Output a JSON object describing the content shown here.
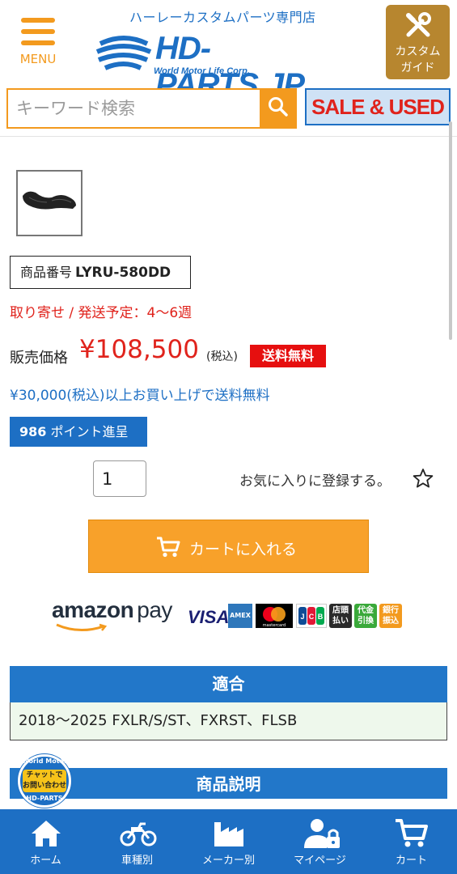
{
  "header": {
    "menu_label": "MENU",
    "tagline": "ハーレーカスタムパーツ専門店",
    "logo_text": "HD-PARTS.JP",
    "logo_sub": "World Motor Life Corp.",
    "guide_label_1": "カスタム",
    "guide_label_2": "ガイド"
  },
  "search": {
    "placeholder": "キーワード検索",
    "value": ""
  },
  "sale_banner": "SALE & USED",
  "product": {
    "sku_label": "商品番号",
    "sku": "LYRU-580DD",
    "ship_schedule": "取り寄せ / 発送予定：4〜6週",
    "price_label": "販売価格",
    "price": "¥108,500",
    "price_tax": "(税込)",
    "free_shipping_badge": "送料無料",
    "free_shipping_note": "¥30,000(税込)以上お買い上げで送料無料",
    "points": "986",
    "points_suffix": " ポイント進呈",
    "quantity": "1",
    "favorite_label": "お気に入りに登録する。",
    "cart_button": "カートに入れる"
  },
  "payments": {
    "amazon": "amazon",
    "pay": "pay",
    "visa": "VISA",
    "amex": "AMERICAN EXPRESS",
    "mastercard": "mastercard",
    "jcb": "JCB",
    "store_pay": [
      "店頭",
      "払い"
    ],
    "cod": [
      "代金",
      "引換"
    ],
    "bank": [
      "銀行",
      "振込"
    ]
  },
  "compat": {
    "heading": "適合",
    "models": "2018～2025 FXLR/S/ST、FXRST、FLSB"
  },
  "description": {
    "heading": "商品説明"
  },
  "chat": {
    "ring_top": "World Motor",
    "line1": "チャットで",
    "line2": "お問い合わせ",
    "ring_bottom": "HD-PARTS"
  },
  "bottom_nav": [
    {
      "label": "ホーム",
      "icon": "home-icon"
    },
    {
      "label": "車種別",
      "icon": "motorcycle-icon"
    },
    {
      "label": "メーカー別",
      "icon": "factory-icon"
    },
    {
      "label": "マイページ",
      "icon": "user-lock-icon"
    },
    {
      "label": "カート",
      "icon": "cart-icon"
    }
  ],
  "colors": {
    "brand_blue": "#1d6fc4",
    "accent_orange": "#f39a1e",
    "price_red": "#e0231c"
  }
}
